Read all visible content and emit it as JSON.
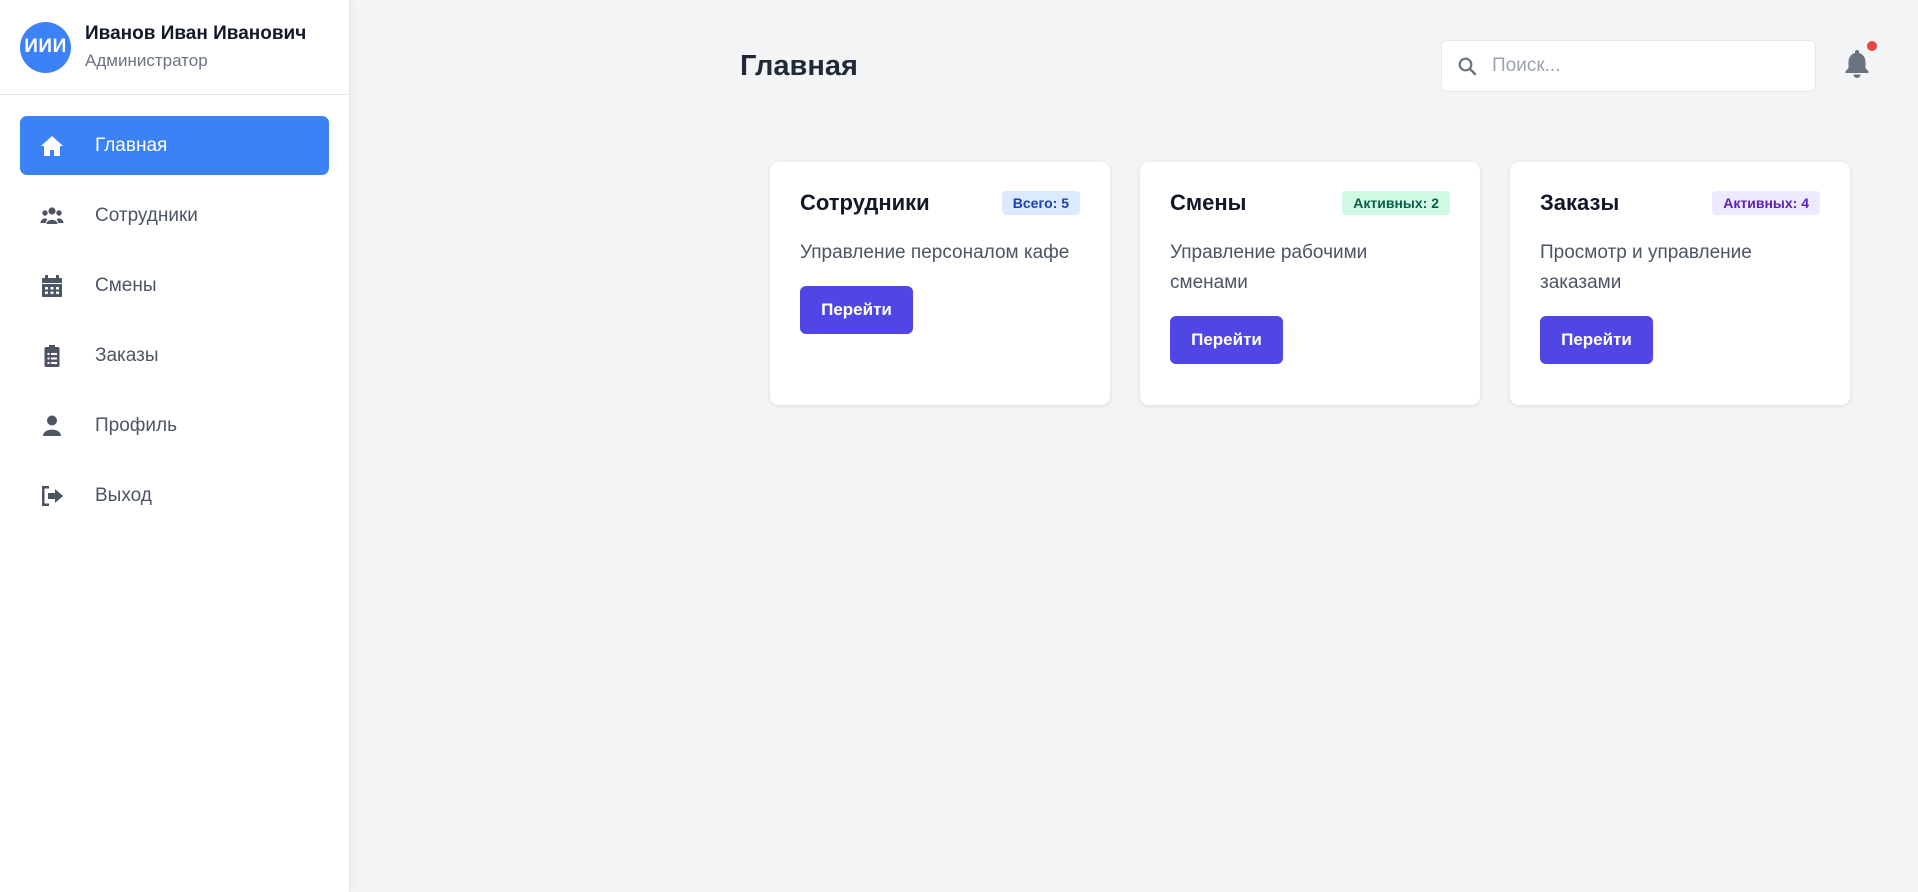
{
  "user": {
    "initials": "ИИИ",
    "name": "Иванов Иван Иванович",
    "role": "Администратор"
  },
  "nav": {
    "items": [
      {
        "label": "Главная",
        "icon": "home-icon",
        "active": true
      },
      {
        "label": "Сотрудники",
        "icon": "users-icon",
        "active": false
      },
      {
        "label": "Смены",
        "icon": "calendar-icon",
        "active": false
      },
      {
        "label": "Заказы",
        "icon": "clipboard-icon",
        "active": false
      },
      {
        "label": "Профиль",
        "icon": "user-icon",
        "active": false
      },
      {
        "label": "Выход",
        "icon": "logout-icon",
        "active": false
      }
    ]
  },
  "header": {
    "title": "Главная",
    "search_placeholder": "Поиск...",
    "notification_icon": "bell-icon",
    "has_notification": true
  },
  "cards": [
    {
      "title": "Сотрудники",
      "badge": "Всего: 5",
      "badge_color": "#dbeafe",
      "description": "Управление персоналом кафе",
      "button": "Перейти"
    },
    {
      "title": "Смены",
      "badge": "Активных: 2",
      "badge_color": "#d1fae5",
      "description": "Управление рабочими сменами",
      "button": "Перейти"
    },
    {
      "title": "Заказы",
      "badge": "Активных: 4",
      "badge_color": "#ede9fe",
      "description": "Просмотр и управление заказами",
      "button": "Перейти"
    }
  ],
  "colors": {
    "accent": "#3b82f6",
    "button": "#4f46e5",
    "notification_dot": "#ef4444"
  }
}
